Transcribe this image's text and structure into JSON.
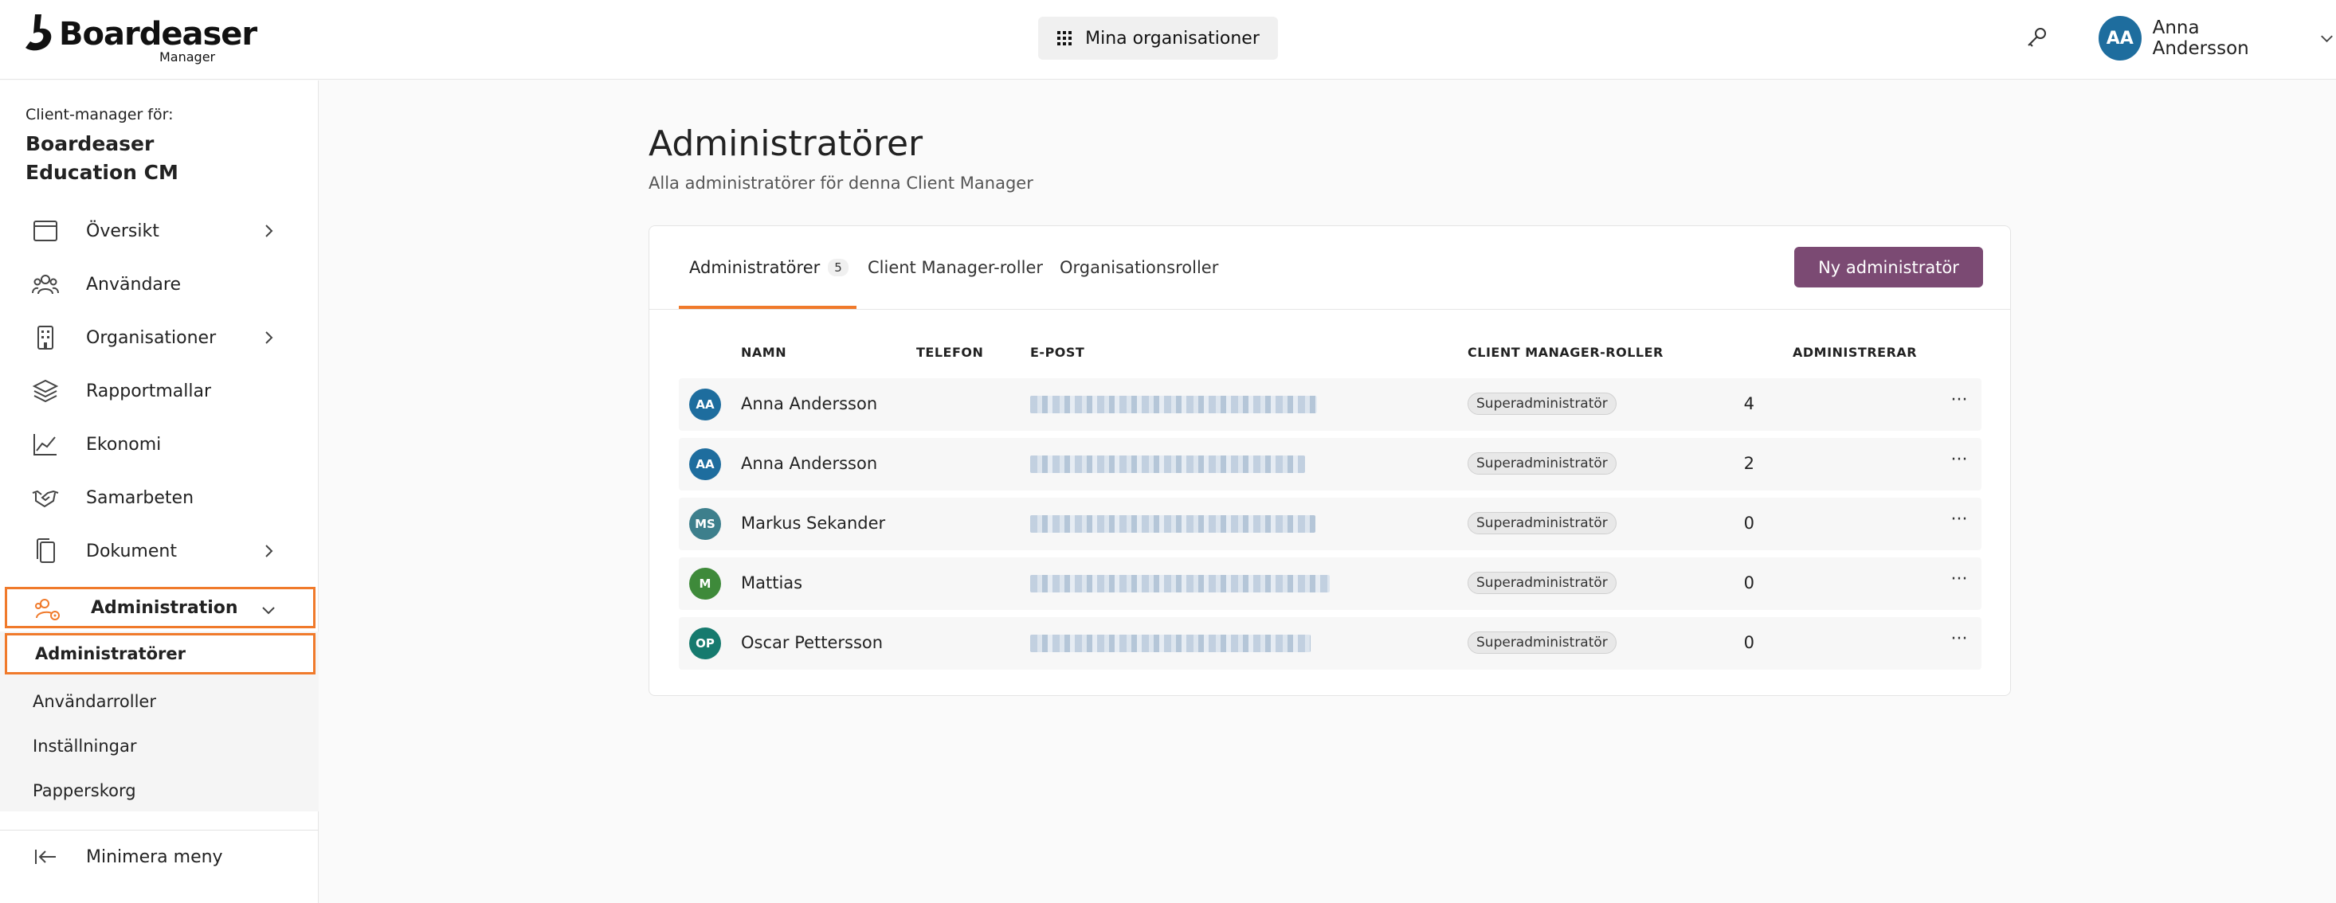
{
  "app": {
    "logo_text": "Boardeaser",
    "logo_sub": "Manager"
  },
  "header": {
    "org_switch_label": "Mina organisationer",
    "user_initials": "AA",
    "user_name": "Anna Andersson",
    "icons": [
      "grid-icon",
      "key-icon",
      "chevron-down-icon"
    ]
  },
  "sidebar": {
    "cm_label": "Client-manager för:",
    "cm_name": "Boardeaser Education CM",
    "items": [
      {
        "label": "Översikt",
        "icon": "calendar-icon",
        "has_chevron": true
      },
      {
        "label": "Användare",
        "icon": "users-icon",
        "has_chevron": false
      },
      {
        "label": "Organisationer",
        "icon": "building-icon",
        "has_chevron": true
      },
      {
        "label": "Rapportmallar",
        "icon": "layers-icon",
        "has_chevron": false
      },
      {
        "label": "Ekonomi",
        "icon": "line-chart-icon",
        "has_chevron": false
      },
      {
        "label": "Samarbeten",
        "icon": "handshake-icon",
        "has_chevron": false
      },
      {
        "label": "Dokument",
        "icon": "documents-icon",
        "has_chevron": true
      },
      {
        "label": "Administration",
        "icon": "admin-users-icon",
        "has_chevron": true,
        "expanded": true
      }
    ],
    "sub_items": [
      {
        "label": "Administratörer",
        "active": true
      },
      {
        "label": "Användarroller"
      },
      {
        "label": "Inställningar"
      },
      {
        "label": "Papperskorg"
      }
    ],
    "minimize_label": "Minimera meny"
  },
  "main": {
    "title": "Administratörer",
    "subtitle": "Alla administratörer för denna Client Manager",
    "tabs": [
      {
        "label": "Administratörer",
        "count": "5",
        "active": true
      },
      {
        "label": "Client Manager-roller"
      },
      {
        "label": "Organisationsroller"
      }
    ],
    "new_admin_label": "Ny administratör",
    "columns": [
      "NAMN",
      "TELEFON",
      "E-POST",
      "CLIENT MANAGER-ROLLER",
      "ADMINISTRERAR"
    ],
    "rows": [
      {
        "initials": "AA",
        "name": "Anna Andersson",
        "role": "Superadministratör",
        "count": "4",
        "avatar_color": "#1e6d9e"
      },
      {
        "initials": "AA",
        "name": "Anna Andersson",
        "role": "Superadministratör",
        "count": "2",
        "avatar_color": "#1e6d9e"
      },
      {
        "initials": "MS",
        "name": "Markus Sekander",
        "role": "Superadministratör",
        "count": "0",
        "avatar_color": "#3d7f8c"
      },
      {
        "initials": "M",
        "name": "Mattias",
        "role": "Superadministratör",
        "count": "0",
        "avatar_color": "#3e8a3a"
      },
      {
        "initials": "OP",
        "name": "Oscar Pettersson",
        "role": "Superadministratör",
        "count": "0",
        "avatar_color": "#167a6e"
      }
    ],
    "more_glyph": "···"
  },
  "colors": {
    "accent_orange": "#f07a2b",
    "primary_button": "#7b4a73",
    "avatar_blue": "#1e6d9e"
  }
}
